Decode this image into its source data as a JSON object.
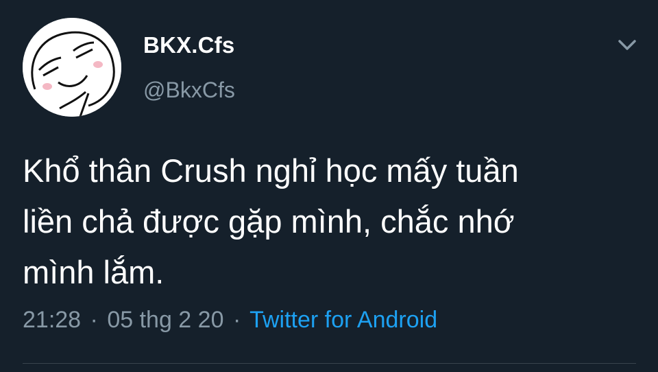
{
  "tweet": {
    "display_name": "BKX.Cfs",
    "handle": "@BkxCfs",
    "text_line_1": "Khổ thân Crush nghỉ học mấy tuần",
    "text_line_2": "liền chả được gặp mình, chắc nhớ",
    "text_line_3": "mình lắm.",
    "time": "21:28",
    "separator": "·",
    "date": "05 thg 2 20",
    "source": "Twitter for Android"
  },
  "icons": {
    "caret": "chevron-down-icon",
    "avatar": "avatar-smug-face"
  },
  "colors": {
    "background": "#15202b",
    "primary_text": "#ffffff",
    "secondary_text": "#8899a6",
    "link": "#1da1f2",
    "divider": "#38444d"
  }
}
